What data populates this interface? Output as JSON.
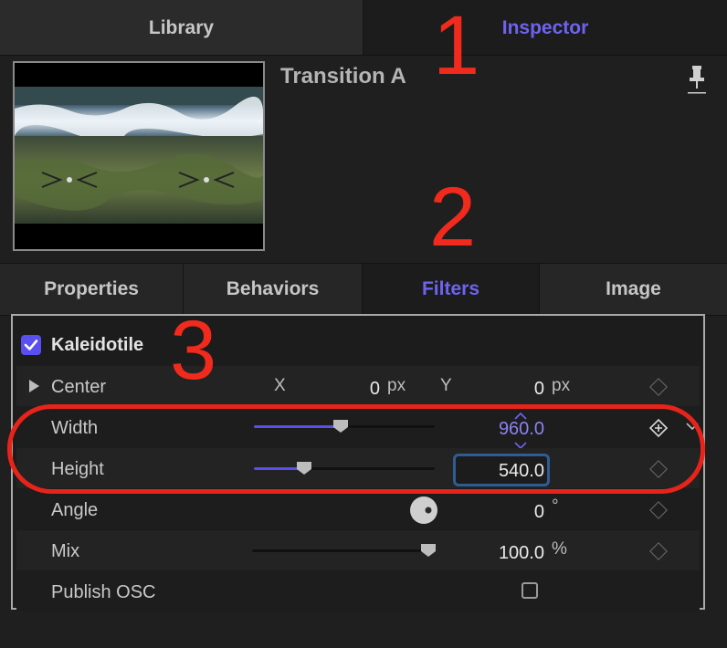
{
  "tabs": {
    "library": "Library",
    "inspector": "Inspector"
  },
  "header": {
    "title": "Transition A"
  },
  "sub_tabs": [
    "Properties",
    "Behaviors",
    "Filters",
    "Image"
  ],
  "filter": {
    "name": "Kaleidotile",
    "enabled": true,
    "params": {
      "center": {
        "label": "Center",
        "x_label": "X",
        "x_value": "0",
        "x_unit": "px",
        "y_label": "Y",
        "y_value": "0",
        "y_unit": "px"
      },
      "width": {
        "label": "Width",
        "value": "960.0"
      },
      "height": {
        "label": "Height",
        "value": "540.0"
      },
      "angle": {
        "label": "Angle",
        "value": "0",
        "unit": "°"
      },
      "mix": {
        "label": "Mix",
        "value": "100.0",
        "unit": "%"
      },
      "publish_osc": {
        "label": "Publish OSC",
        "checked": false
      }
    }
  },
  "annotations": {
    "one": "1",
    "two": "2",
    "three": "3"
  },
  "colors": {
    "accent": "#5a4ff0",
    "active_tab_text": "#6e63f0",
    "annotation_red": "#e8241a"
  }
}
